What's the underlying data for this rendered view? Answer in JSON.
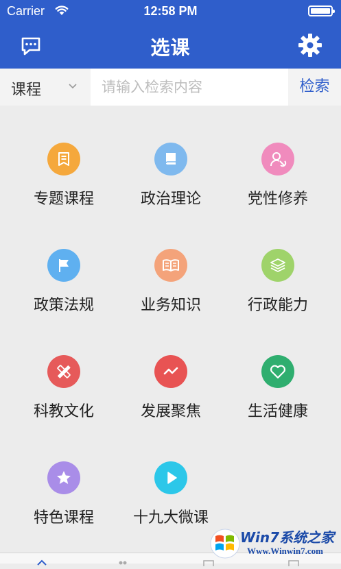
{
  "status_bar": {
    "carrier": "Carrier",
    "time": "12:58 PM"
  },
  "nav": {
    "title": "选课",
    "left_icon": "message-icon",
    "right_icon": "gear-icon"
  },
  "search": {
    "scope_value": "课程",
    "placeholder": "请输入检索内容",
    "button_label": "检索"
  },
  "categories": [
    {
      "label": "专题课程",
      "icon": "bookmark-icon",
      "color": "#f5a83c"
    },
    {
      "label": "政治理论",
      "icon": "book-icon",
      "color": "#7fb9ee"
    },
    {
      "label": "党性修养",
      "icon": "party-emblem-icon",
      "color": "#f08bbd"
    },
    {
      "label": "政策法规",
      "icon": "flag-icon",
      "color": "#5fb0f0"
    },
    {
      "label": "业务知识",
      "icon": "open-book-icon",
      "color": "#f4a37a"
    },
    {
      "label": "行政能力",
      "icon": "layers-icon",
      "color": "#9fd36a"
    },
    {
      "label": "科教文化",
      "icon": "pencil-ruler-icon",
      "color": "#e65a5a"
    },
    {
      "label": "发展聚焦",
      "icon": "trend-line-icon",
      "color": "#e85353"
    },
    {
      "label": "生活健康",
      "icon": "heart-icon",
      "color": "#2fae6f"
    },
    {
      "label": "特色课程",
      "icon": "star-icon",
      "color": "#a98de8"
    },
    {
      "label": "十九大微课",
      "icon": "play-icon",
      "color": "#2cc7e9"
    }
  ],
  "watermark": {
    "brand": "Win7系统之家",
    "url": "Www.Winwin7.com"
  },
  "colors": {
    "header": "#2f5ecb",
    "accent": "#2f5ecb",
    "background": "#ececec"
  }
}
